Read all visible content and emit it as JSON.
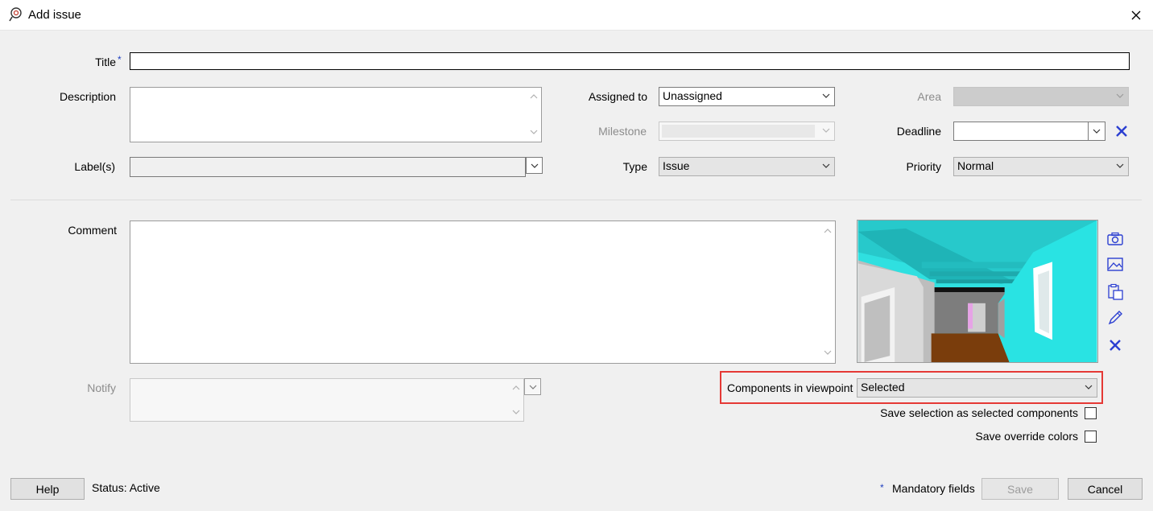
{
  "window": {
    "title": "Add issue"
  },
  "form": {
    "title_label": "Title",
    "mandatory_mark": "*",
    "description_label": "Description",
    "assigned_to_label": "Assigned to",
    "assigned_to_value": "Unassigned",
    "area_label": "Area",
    "milestone_label": "Milestone",
    "deadline_label": "Deadline",
    "labels_label": "Label(s)",
    "type_label": "Type",
    "type_value": "Issue",
    "priority_label": "Priority",
    "priority_value": "Normal",
    "comment_label": "Comment",
    "notify_label": "Notify",
    "components_label": "Components in viewpoint",
    "components_value": "Selected",
    "save_selection_label": "Save selection as selected components",
    "save_override_label": "Save override colors"
  },
  "footer": {
    "help_label": "Help",
    "status_text": "Status: Active",
    "mandatory_note": "Mandatory fields",
    "save_label": "Save",
    "cancel_label": "Cancel"
  },
  "icons": {
    "app": "issue-icon",
    "close": "close-icon",
    "camera": "camera-icon",
    "image": "image-icon",
    "paste": "paste-icon",
    "pencil": "pencil-icon",
    "delete": "delete-icon"
  },
  "colors": {
    "accent_blue": "#2b3fd1",
    "highlight_red": "#e53935",
    "mandatory_star": "#1f3fbf"
  }
}
